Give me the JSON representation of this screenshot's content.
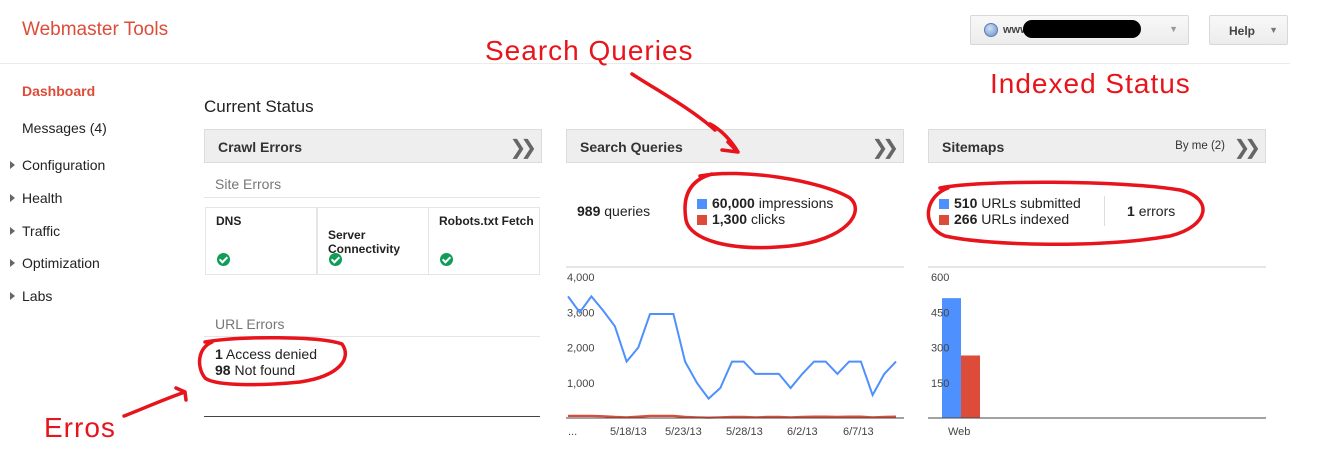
{
  "app": {
    "title": "Webmaster Tools"
  },
  "header": {
    "site_prefix": "www",
    "help_label": "Help",
    "caret": "▼"
  },
  "sidebar": {
    "items": [
      {
        "label": "Dashboard",
        "active": true,
        "expandable": false
      },
      {
        "label": "Messages (4)",
        "active": false,
        "expandable": false
      },
      {
        "label": "Configuration",
        "active": false,
        "expandable": true
      },
      {
        "label": "Health",
        "active": false,
        "expandable": true
      },
      {
        "label": "Traffic",
        "active": false,
        "expandable": true
      },
      {
        "label": "Optimization",
        "active": false,
        "expandable": true
      },
      {
        "label": "Labs",
        "active": false,
        "expandable": true
      }
    ]
  },
  "main": {
    "title": "Current Status",
    "crawl": {
      "header": "Crawl Errors",
      "site_errors_label": "Site Errors",
      "cells": [
        "DNS",
        "Server\nConnectivity",
        "Robots.txt Fetch"
      ],
      "url_errors_label": "URL Errors",
      "url_errors": [
        {
          "count": "1",
          "label": "Access denied"
        },
        {
          "count": "98",
          "label": "Not found"
        }
      ]
    },
    "queries": {
      "header": "Search Queries",
      "count": "989",
      "count_label": "queries",
      "impressions": "60,000",
      "impressions_label": "impressions",
      "clicks": "1,300",
      "clicks_label": "clicks"
    },
    "sitemaps": {
      "header": "Sitemaps",
      "by_me": "By me (2)",
      "submitted": "510",
      "submitted_label": "URLs submitted",
      "indexed": "266",
      "indexed_label": "URLs indexed",
      "errors": "1",
      "errors_label": "errors"
    }
  },
  "annotations": {
    "search_queries": "Search  Queries",
    "indexed_status": "Indexed  Status",
    "errors": "Erros"
  },
  "colors": {
    "accent": "#dd4b39",
    "blue": "#4d90fe",
    "red": "#dd4b39",
    "annotation": "#e8141c",
    "ok": "#0f9d58"
  },
  "chart_data": [
    {
      "type": "line",
      "x_tick_labels": [
        "...",
        "5/18/13",
        "5/23/13",
        "5/28/13",
        "6/2/13",
        "6/7/13"
      ],
      "yticks": [
        "4,000",
        "3,000",
        "2,000",
        "1,000"
      ],
      "ylim": [
        0,
        4000
      ],
      "series": [
        {
          "name": "impressions",
          "color": "#4d90fe",
          "values": [
            3450,
            3000,
            3450,
            3050,
            2600,
            1600,
            2000,
            2950,
            2950,
            2950,
            1600,
            1000,
            550,
            850,
            1600,
            1600,
            1250,
            1250,
            1250,
            850,
            1250,
            1600,
            1600,
            1250,
            1600,
            1600,
            650,
            1250,
            1600
          ]
        },
        {
          "name": "clicks",
          "color": "#dd4b39",
          "values": [
            60,
            60,
            60,
            50,
            30,
            20,
            40,
            60,
            60,
            60,
            30,
            20,
            10,
            20,
            30,
            30,
            20,
            30,
            30,
            20,
            30,
            40,
            40,
            30,
            40,
            40,
            20,
            30,
            40
          ]
        }
      ]
    },
    {
      "type": "bar",
      "categories": [
        "Web"
      ],
      "yticks": [
        "600",
        "450",
        "300",
        "150"
      ],
      "ylim": [
        0,
        600
      ],
      "series": [
        {
          "name": "URLs submitted",
          "color": "#4d90fe",
          "values": [
            510
          ]
        },
        {
          "name": "URLs indexed",
          "color": "#dd4b39",
          "values": [
            266
          ]
        }
      ]
    }
  ]
}
